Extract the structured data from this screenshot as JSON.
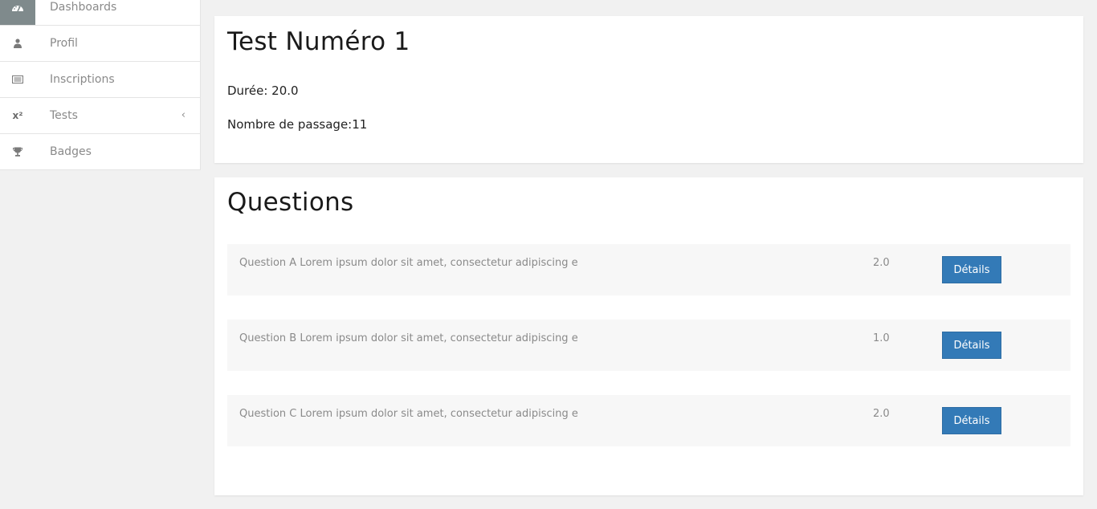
{
  "sidebar": {
    "items": [
      {
        "label": "Dashboards",
        "icon": "dashboard-icon"
      },
      {
        "label": "Profil",
        "icon": "user-icon"
      },
      {
        "label": "Inscriptions",
        "icon": "list-icon"
      },
      {
        "label": "Tests",
        "icon": "superscript-icon",
        "icon_text": "x²",
        "chevron": "‹"
      },
      {
        "label": "Badges",
        "icon": "trophy-icon"
      }
    ]
  },
  "test": {
    "title": "Test Numéro 1",
    "duration": "Durée: 20.0",
    "passages": "Nombre de passage:11"
  },
  "questions": {
    "title": "Questions",
    "button_label": "Détails",
    "items": [
      {
        "text": "Question A Lorem ipsum dolor sit amet, consectetur adipiscing e",
        "score": "2.0"
      },
      {
        "text": "Question B Lorem ipsum dolor sit amet, consectetur adipiscing e",
        "score": "1.0"
      },
      {
        "text": "Question C Lorem ipsum dolor sit amet, consectetur adipiscing e",
        "score": "2.0"
      }
    ]
  },
  "colors": {
    "accent": "#337ab7",
    "active_icon_bg": "#7f8a8c"
  }
}
